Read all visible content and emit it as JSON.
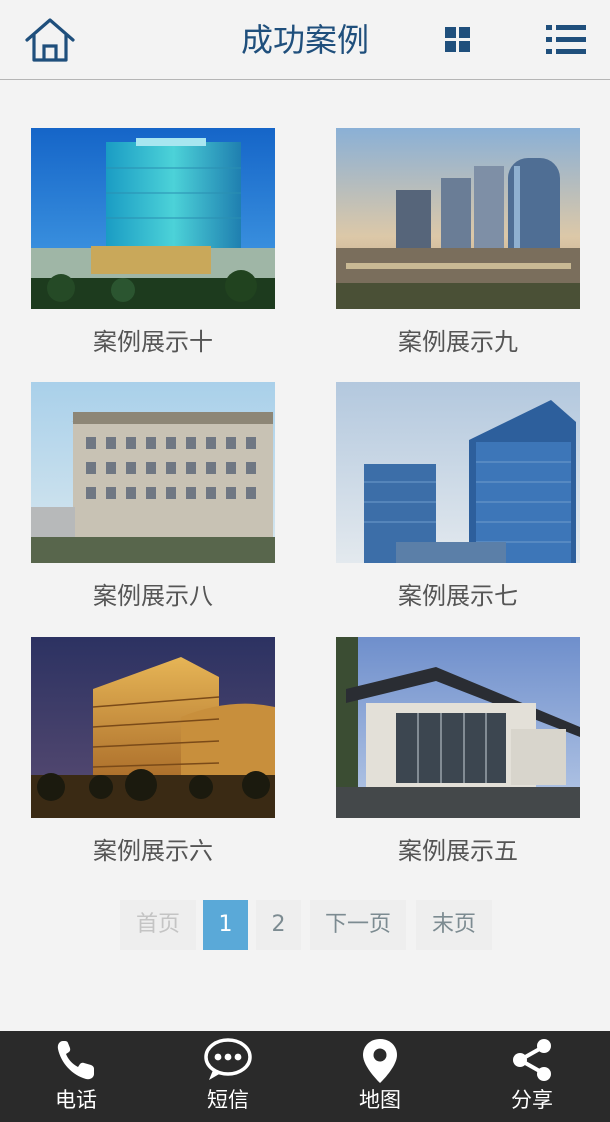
{
  "header": {
    "title": "成功案例"
  },
  "cases": [
    {
      "caption": "案例展示十"
    },
    {
      "caption": "案例展示九"
    },
    {
      "caption": "案例展示八"
    },
    {
      "caption": "案例展示七"
    },
    {
      "caption": "案例展示六"
    },
    {
      "caption": "案例展示五"
    }
  ],
  "pagination": {
    "first": "首页",
    "pages": [
      "1",
      "2"
    ],
    "current": "1",
    "next": "下一页",
    "last": "末页"
  },
  "bottom_nav": [
    {
      "label": "电话",
      "icon": "phone-icon"
    },
    {
      "label": "短信",
      "icon": "message-icon"
    },
    {
      "label": "地图",
      "icon": "map-pin-icon"
    },
    {
      "label": "分享",
      "icon": "share-icon"
    }
  ],
  "colors": {
    "brand": "#1f4f7c",
    "page_bg": "#f3f3f3",
    "pager_active": "#5aa9d8",
    "nav_bg": "#2a2a2a"
  }
}
